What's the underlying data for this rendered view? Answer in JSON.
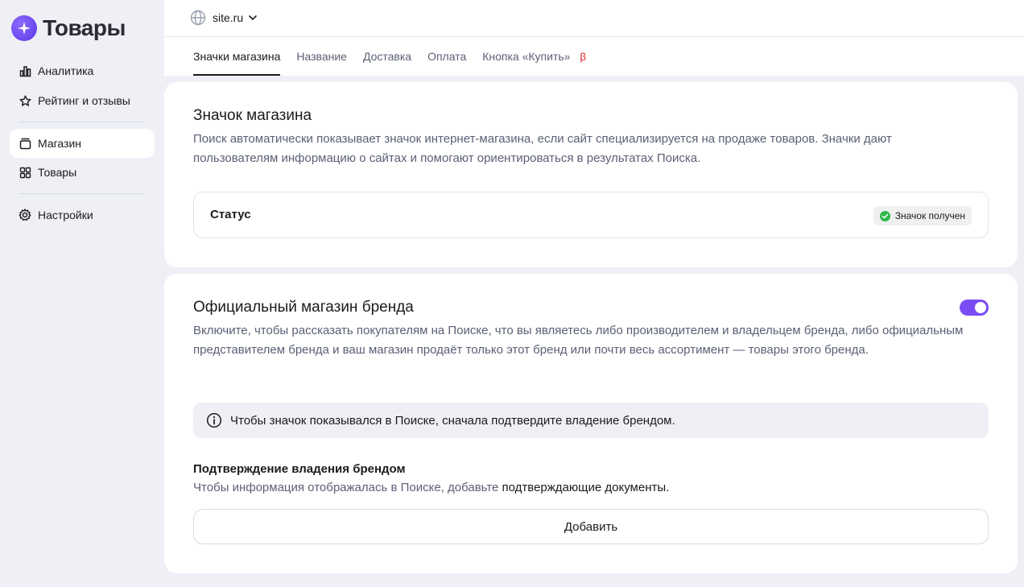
{
  "app": {
    "title": "Товары"
  },
  "sidebar": {
    "items": [
      {
        "label": "Аналитика",
        "icon": "analytics-icon"
      },
      {
        "label": "Рейтинг и отзывы",
        "icon": "star-icon"
      },
      {
        "label": "Магазин",
        "icon": "store-icon",
        "active": true
      },
      {
        "label": "Товары",
        "icon": "grid-icon"
      },
      {
        "label": "Настройки",
        "icon": "gear-icon"
      }
    ]
  },
  "header": {
    "site": "site.ru",
    "tabs": [
      {
        "label": "Значки магазина",
        "active": true
      },
      {
        "label": "Название"
      },
      {
        "label": "Доставка"
      },
      {
        "label": "Оплата"
      },
      {
        "label": "Кнопка «Купить»"
      }
    ],
    "beta": "β"
  },
  "store_badge": {
    "title": "Значок магазина",
    "description": "Поиск автоматически показывает значок интернет-магазина, если сайт специализируется на продаже товаров. Значки дают пользователям информацию о сайтах и помогают ориентироваться в результатах Поиска.",
    "status_label": "Статус",
    "status_value": "Значок получен"
  },
  "brand_store": {
    "title": "Официальный магазин бренда",
    "toggle_on": true,
    "description": "Включите, чтобы рассказать покупателям на Поиске, что вы являетесь либо производителем и владельцем бренда, либо официальным представителем бренда и ваш магазин продаёт только этот бренд или почти весь ассортимент — товары этого бренда.",
    "info": "Чтобы значок показывался в Поиске, сначала подтвердите владение брендом.",
    "ownership_title": "Подтверждение владения брендом",
    "ownership_desc": "Чтобы информация отображалась в Поиске, добавьте ",
    "ownership_link": "подтверждающие документы.",
    "add_button": "Добавить"
  },
  "colors": {
    "accent": "#7a4df2",
    "success": "#2cb84b",
    "beta": "#e3151c"
  }
}
